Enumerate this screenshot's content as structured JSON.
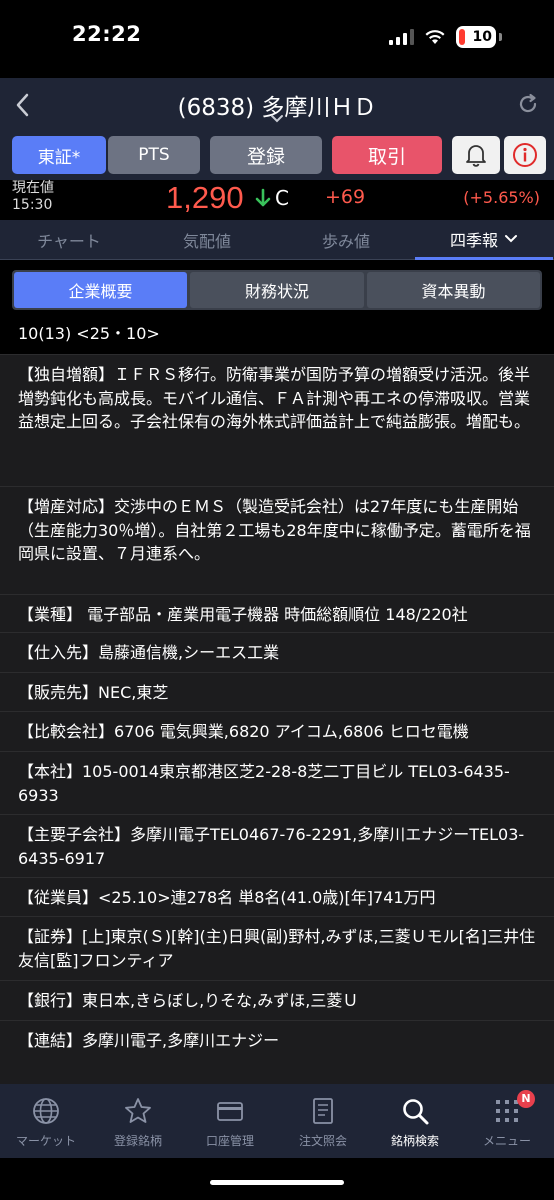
{
  "status": {
    "time": "22:22",
    "battery": "10"
  },
  "header": {
    "title": "(6838) 多摩川ＨＤ"
  },
  "buttons": {
    "tosho": "東証*",
    "pts": "PTS",
    "register": "登録",
    "trade": "取引"
  },
  "price": {
    "label_now": "現在値",
    "time": "15:30",
    "value": "1,290",
    "flag": "C",
    "change": "+69",
    "change_pct": "(+5.65%)",
    "up_color": "#ff5a4d"
  },
  "tabs": [
    "チャート",
    "気配値",
    "歩み値",
    "四季報"
  ],
  "subtabs": [
    "企業概要",
    "財務状況",
    "資本異動"
  ],
  "content": {
    "date": "10(13) <25・10>",
    "sections": [
      "【独自増額】ＩＦＲＳ移行。防衛事業が国防予算の増額受け活況。後半増勢鈍化も高成長。モバイル通信、ＦＡ計測や再エネの停滞吸収。営業益想定上回る。子会社保有の海外株式評価益計上で純益膨張。増配も。",
      "【増産対応】交渉中のＥＭＳ（製造受託会社）は27年度にも生産開始（生産能力30％増）。自社第２工場も28年度中に稼働予定。蓄電所を福岡県に設置、７月連系へ。",
      "【業種】 電子部品・産業用電子機器 時価総額順位 148/220社",
      "【仕入先】島藤通信機,シーエス工業",
      "【販売先】NEC,東芝",
      "【比較会社】6706 電気興業,6820 アイコム,6806 ヒロセ電機",
      "【本社】105-0014東京都港区芝2-28-8芝二丁目ビル TEL03-6435-6933",
      "【主要子会社】多摩川電子TEL0467-76-2291,多摩川エナジーTEL03-6435-6917",
      "【従業員】<25.10>連278名 単8名(41.0歳)[年]741万円",
      "【証券】[上]東京(Ｓ)[幹](主)日興(副)野村,みずほ,三菱Ｕモル[名]三井住友信[監]フロンティア",
      "【銀行】東日本,きらぼし,りそな,みずほ,三菱Ｕ",
      "【連結】多摩川電子,多摩川エナジー"
    ]
  },
  "tabbar": [
    {
      "label": "マーケット",
      "icon": "globe-icon"
    },
    {
      "label": "登録銘柄",
      "icon": "star-icon"
    },
    {
      "label": "口座管理",
      "icon": "card-icon"
    },
    {
      "label": "注文照会",
      "icon": "document-icon"
    },
    {
      "label": "銘柄検索",
      "icon": "search-icon"
    },
    {
      "label": "メニュー",
      "icon": "grid-icon",
      "badge": "N"
    }
  ]
}
